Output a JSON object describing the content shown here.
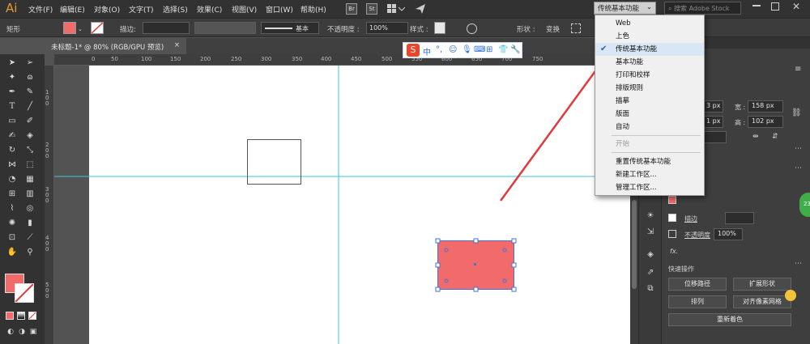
{
  "app": {
    "logo": "Ai"
  },
  "menu": [
    "文件(F)",
    "编辑(E)",
    "对象(O)",
    "文字(T)",
    "选择(S)",
    "效果(C)",
    "视图(V)",
    "窗口(W)",
    "帮助(H)"
  ],
  "menubar_icons": {
    "bridge": "Br",
    "stock": "St"
  },
  "workspace": {
    "current": "传统基本功能"
  },
  "search": {
    "placeholder": "搜索 Adobe Stock"
  },
  "control": {
    "object_type": "矩形",
    "stroke_label": "描边:",
    "stroke_style": "基本",
    "opacity_label": "不透明度 :",
    "opacity_value": "100%",
    "style_label": "样式 :",
    "shape_label": "形状 :",
    "transform_label": "变换"
  },
  "document": {
    "tab_title": "未标题-1* @ 80% (RGB/GPU 预览)"
  },
  "ruler": {
    "top": [
      "0",
      "50",
      "100",
      "150",
      "200",
      "250",
      "300",
      "350",
      "400",
      "450",
      "500",
      "550",
      "600",
      "650",
      "700",
      "750"
    ],
    "left": [
      "1 0 0",
      "2 0 0",
      "3 0 0",
      "4 0 0",
      "5 0 0"
    ]
  },
  "ime": {
    "logo": "S",
    "lang": "中"
  },
  "dropdown": {
    "items": [
      {
        "label": "Web",
        "checked": false,
        "disabled": false
      },
      {
        "label": "上色",
        "checked": false,
        "disabled": false
      },
      {
        "label": "传统基本功能",
        "checked": true,
        "disabled": false
      },
      {
        "label": "基本功能",
        "checked": false,
        "disabled": false
      },
      {
        "label": "打印和校样",
        "checked": false,
        "disabled": false
      },
      {
        "label": "排版规则",
        "checked": false,
        "disabled": false
      },
      {
        "label": "描摹",
        "checked": false,
        "disabled": false
      },
      {
        "label": "版面",
        "checked": false,
        "disabled": false
      },
      {
        "label": "自动",
        "checked": false,
        "disabled": false
      },
      {
        "label": "开始",
        "checked": false,
        "disabled": true
      },
      {
        "label": "重置传统基本功能",
        "checked": false,
        "disabled": false
      },
      {
        "label": "新建工作区...",
        "checked": false,
        "disabled": false
      },
      {
        "label": "管理工作区...",
        "checked": false,
        "disabled": false
      }
    ]
  },
  "panel": {
    "x_value": "3 px",
    "y_value": "1 px",
    "width_label": "宽 :",
    "width_value": "158 px",
    "height_label": "高 :",
    "height_value": "102 px",
    "stroke_label": "描边",
    "opacity_label": "不透明度",
    "opacity_value": "100%",
    "fx_label": "fx.",
    "quick_actions_label": "快速操作",
    "buttons": {
      "offset_path": "位移路径",
      "expand_shape": "扩展形状",
      "arrange": "排列",
      "align_pixel": "对齐像素网格",
      "recolor": "重新着色"
    }
  },
  "floating_badge": "23",
  "colors": {
    "fill": "#f26b6b",
    "accent_arrow": "#e23a3a",
    "guide": "#3ec7d6"
  }
}
